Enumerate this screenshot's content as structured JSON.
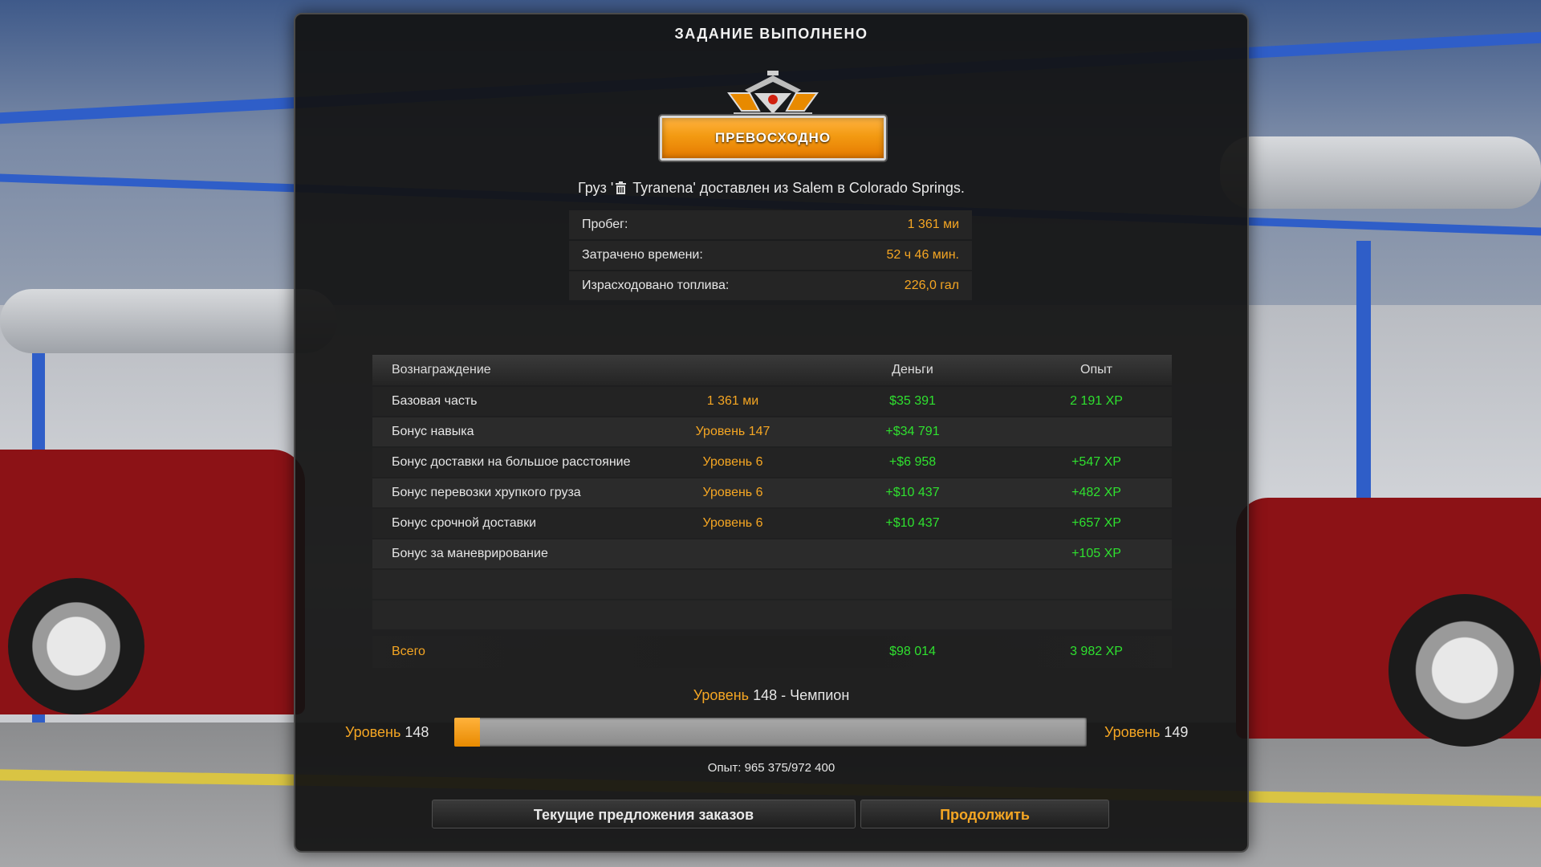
{
  "panel": {
    "title": "ЗАДАНИЕ ВЫПОЛНЕНО",
    "rating": "ПРЕВОСХОДНО",
    "delivered_prefix": "Груз '",
    "delivered_icon": "trash-can-icon",
    "delivered_suffix": " Tyranena' доставлен из Salem в Colorado Springs."
  },
  "stats": [
    {
      "label": "Пробег:",
      "value": "1 361 ми"
    },
    {
      "label": "Затрачено времени:",
      "value": "52 ч 46 мин."
    },
    {
      "label": "Израсходовано топлива:",
      "value": "226,0 гал"
    }
  ],
  "rewards": {
    "headers": {
      "reward": "Вознаграждение",
      "money": "Деньги",
      "xp": "Опыт"
    },
    "rows": [
      {
        "name": "Базовая часть",
        "detail": "1 361 ми",
        "money": "$35 391",
        "xp": "2 191 XP"
      },
      {
        "name": "Бонус навыка",
        "detail": "Уровень 147",
        "money": "+$34 791",
        "xp": ""
      },
      {
        "name": "Бонус доставки на большое расстояние",
        "detail": "Уровень 6",
        "money": "+$6 958",
        "xp": "+547 XP"
      },
      {
        "name": "Бонус перевозки хрупкого груза",
        "detail": "Уровень 6",
        "money": "+$10 437",
        "xp": "+482 XP"
      },
      {
        "name": "Бонус срочной доставки",
        "detail": "Уровень 6",
        "money": "+$10 437",
        "xp": "+657 XP"
      },
      {
        "name": "Бонус за маневрирование",
        "detail": "",
        "money": "",
        "xp": "+105 XP"
      }
    ],
    "total": {
      "label": "Всего",
      "money": "$98 014",
      "xp": "3 982 XP"
    }
  },
  "level": {
    "word": "Уровень",
    "current": "148",
    "rank_suffix": " - Чемпион",
    "next": "149",
    "xp_text": "Опыт: 965 375/972 400",
    "progress_fraction": 0.04
  },
  "buttons": {
    "offers": "Текущие предложения заказов",
    "continue": "Продолжить"
  },
  "colors": {
    "accent": "#f5a623",
    "positive": "#2fe02f"
  }
}
